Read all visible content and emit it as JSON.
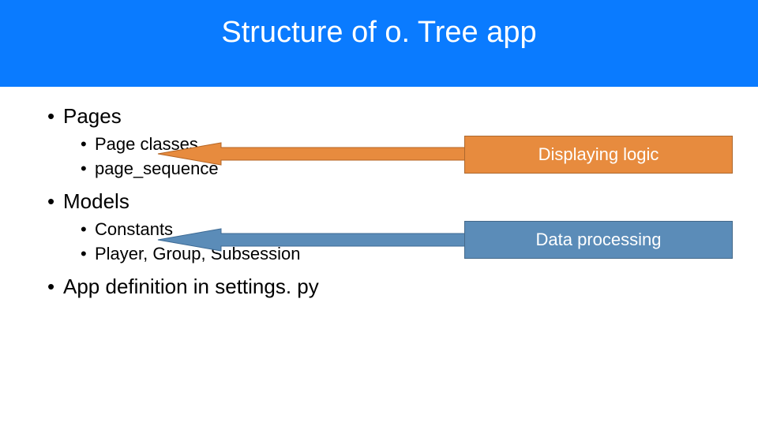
{
  "header": {
    "title": "Structure of o. Tree app"
  },
  "bullets": {
    "pages": "Pages",
    "page_classes": "Page classes",
    "page_sequence": "page_sequence",
    "models": "Models",
    "constants": "Constants",
    "pgs": "Player, Group, Subsession",
    "app_def": "App definition in settings. py"
  },
  "callouts": {
    "displaying": "Displaying logic",
    "data": "Data processing"
  }
}
